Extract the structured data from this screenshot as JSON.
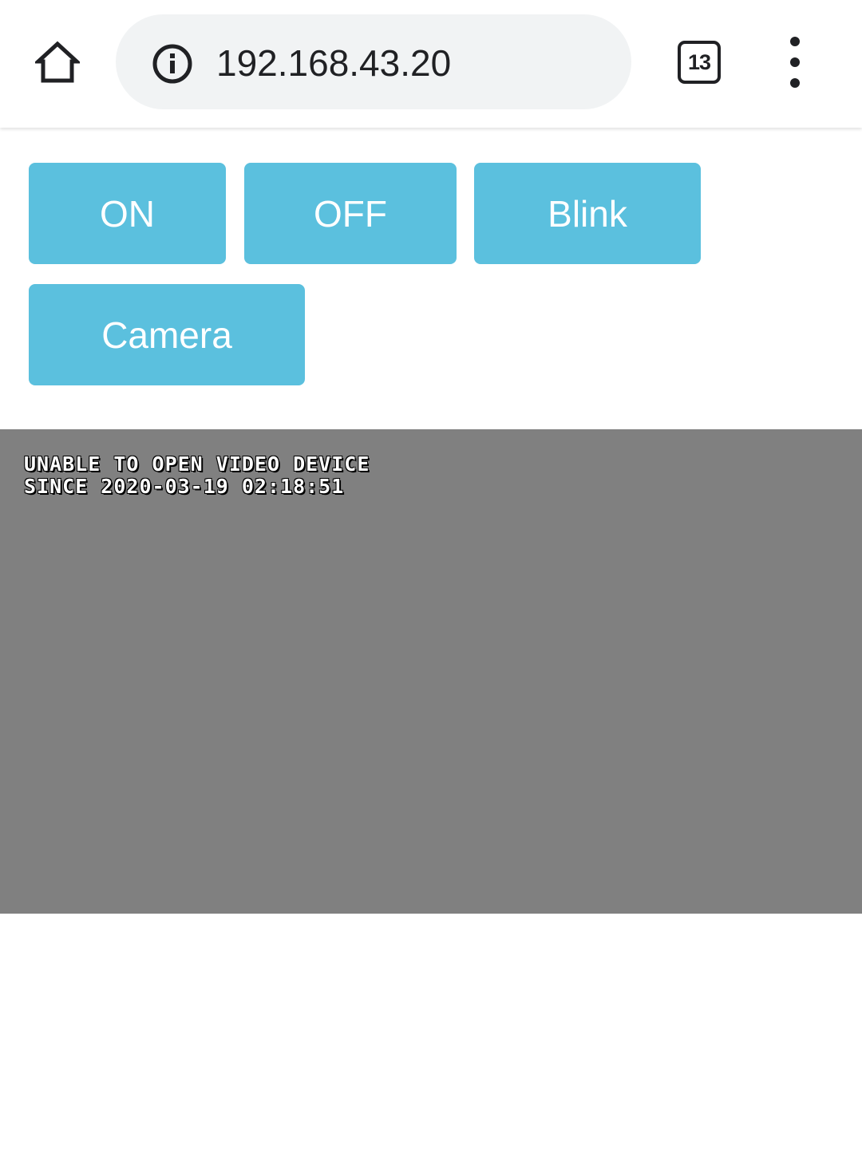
{
  "browser": {
    "url": "192.168.43.20",
    "tab_count": "13",
    "icons": {
      "home": "home-icon",
      "info": "info-icon",
      "tabs": "tab-switcher-icon",
      "menu": "more-vert-icon"
    }
  },
  "controls": {
    "on_label": "ON",
    "off_label": "OFF",
    "blink_label": "Blink",
    "camera_label": "Camera",
    "button_color": "#5bc0de"
  },
  "video": {
    "line1": "UNABLE TO OPEN VIDEO DEVICE",
    "line2": "SINCE 2020-03-19 02:18:51",
    "background_color": "#808080"
  }
}
